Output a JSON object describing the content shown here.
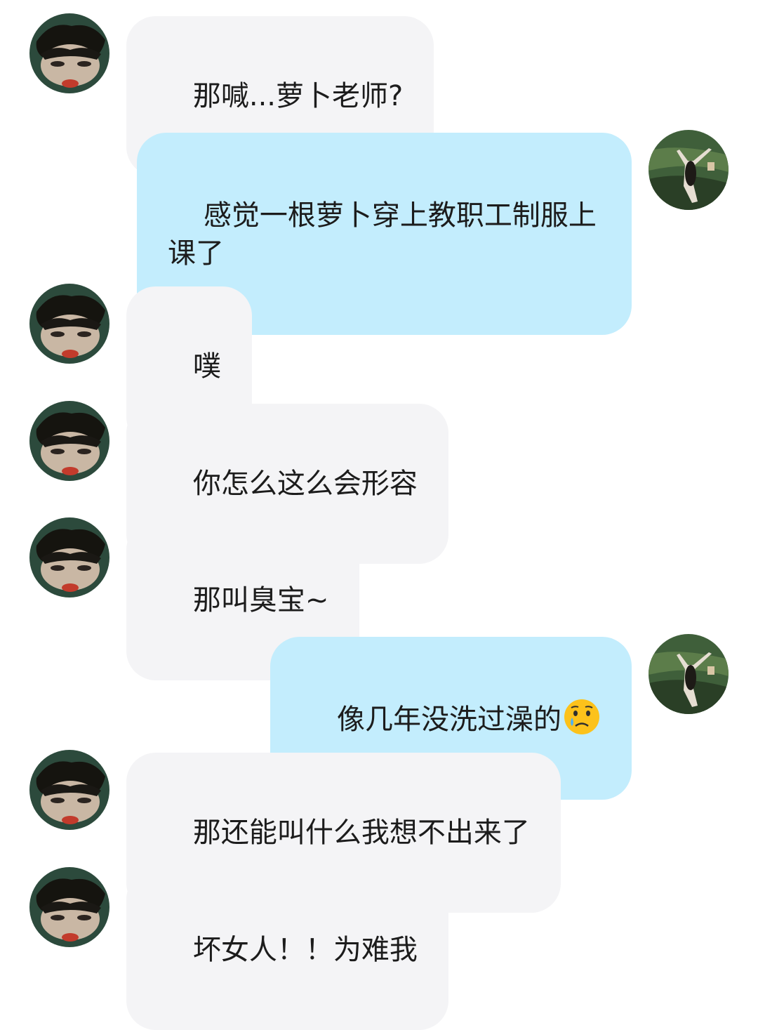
{
  "conversation": {
    "messages": [
      {
        "sender": "friend",
        "text": "那喊...萝卜老师?"
      },
      {
        "sender": "me",
        "text": "感觉一根萝卜穿上教职工制服上课了"
      },
      {
        "sender": "friend",
        "text": "噗"
      },
      {
        "sender": "friend",
        "text": "你怎么这么会形容"
      },
      {
        "sender": "friend",
        "text": "那叫臭宝~"
      },
      {
        "sender": "me",
        "text": "像几年没洗过澡的",
        "emoji": "crying-face-emoji"
      },
      {
        "sender": "friend",
        "text": "那还能叫什么我想不出来了"
      },
      {
        "sender": "friend",
        "text": "坏女人！！为难我"
      }
    ]
  },
  "colors": {
    "incoming_bubble": "#f4f4f6",
    "outgoing_bubble": "#c3edfd",
    "text": "#1c1c1c",
    "background": "#ffffff"
  },
  "icons": {
    "friend_avatar": "friend-avatar-icon",
    "my_avatar": "my-avatar-icon",
    "emoji": "crying-face-emoji"
  }
}
